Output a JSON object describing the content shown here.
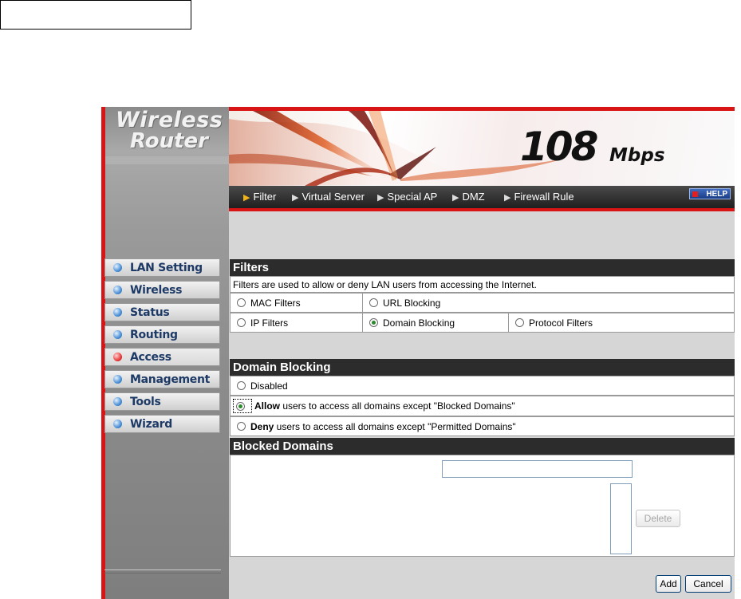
{
  "logo": {
    "line1": "Wireless",
    "line2": "Router"
  },
  "banner": {
    "speed": "108",
    "unit": "Mbps"
  },
  "tabs": [
    {
      "label": "Filter"
    },
    {
      "label": "Virtual Server"
    },
    {
      "label": "Special AP"
    },
    {
      "label": "DMZ"
    },
    {
      "label": "Firewall Rule"
    }
  ],
  "help_label": "HELP",
  "sidebar": {
    "items": [
      {
        "label": "LAN Setting"
      },
      {
        "label": "Wireless"
      },
      {
        "label": "Status"
      },
      {
        "label": "Routing"
      },
      {
        "label": "Access"
      },
      {
        "label": "Management"
      },
      {
        "label": "Tools"
      },
      {
        "label": "Wizard"
      }
    ],
    "active": "Access"
  },
  "filters": {
    "title": "Filters",
    "description": "Filters are used to allow or deny LAN users from accessing the Internet.",
    "options": [
      {
        "label": "MAC Filters",
        "selected": false
      },
      {
        "label": "URL Blocking",
        "selected": false
      },
      {
        "label": "IP Filters",
        "selected": false
      },
      {
        "label": "Domain Blocking",
        "selected": true
      },
      {
        "label": "Protocol Filters",
        "selected": false
      }
    ]
  },
  "domain_blocking": {
    "title": "Domain Blocking",
    "disabled_label": "Disabled",
    "allow_bold": "Allow",
    "allow_rest": " users to access all domains except \"Blocked Domains\"",
    "deny_bold": "Deny",
    "deny_rest": " users to access all domains except \"Permitted Domains\"",
    "selected": "Allow"
  },
  "blocked_domains": {
    "title": "Blocked Domains",
    "input_value": "",
    "delete_label": "Delete"
  },
  "footer": {
    "add_label": "Add",
    "cancel_label": "Cancel"
  }
}
